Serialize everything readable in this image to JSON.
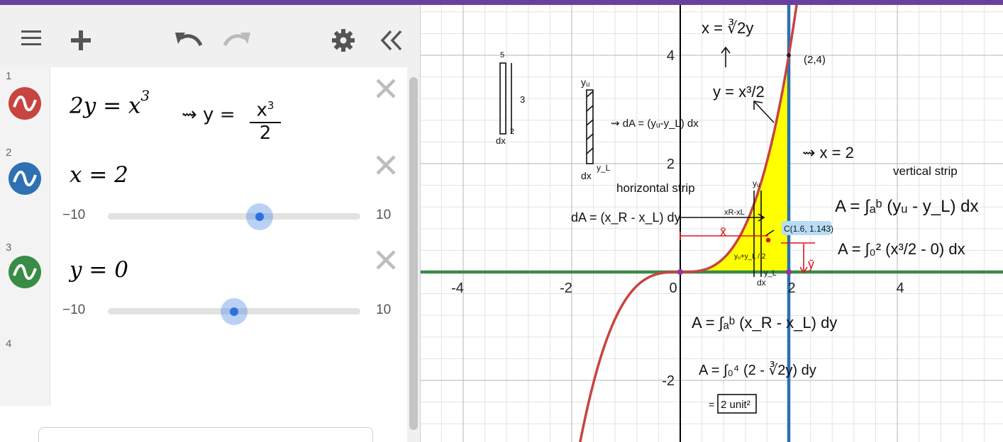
{
  "colors": {
    "top_bar": "#6b3fa0",
    "expr1": "#c74440",
    "expr2": "#2d70b3",
    "expr3": "#388c46",
    "fill": "#ffff00",
    "slider_dot": "#2d70e0"
  },
  "toolbar": {
    "menu_icon": "hamburger-icon",
    "add_icon": "plus-icon",
    "undo_icon": "undo-icon",
    "redo_icon": "redo-icon",
    "settings_icon": "gear-icon",
    "collapse_icon": "double-chevron-left-icon"
  },
  "expressions": [
    {
      "index": "1",
      "lhs": "2y = x",
      "exp": "3",
      "note_lhs": "⇝ y =",
      "note_num": "x",
      "note_num_exp": "3",
      "note_den": "2"
    },
    {
      "index": "2",
      "latex": "x = 2",
      "slider_min": "−10",
      "slider_max": "10",
      "value": 2
    },
    {
      "index": "3",
      "latex": "y = 0",
      "slider_min": "−10",
      "slider_max": "10",
      "value": 0
    },
    {
      "index": "4"
    }
  ],
  "graph": {
    "x_ticks": [
      "-4",
      "-2",
      "0",
      "2",
      "4"
    ],
    "y_ticks": [
      "4",
      "2",
      "-2"
    ],
    "x_range": [
      -4.8,
      5.9
    ],
    "y_range": [
      -3.0,
      5.0
    ],
    "point_label": "(2,4)",
    "annotations": {
      "top_eq": "x = ∛2y",
      "curve_eq": "y = x³/2",
      "line_label": "⇝ x = 2",
      "vertical_strip": "vertical strip",
      "area_vertical_general": "A = ∫ₐᵇ (yᵤ - y_L) dx",
      "area_vertical_specific": "A = ∫₀² (x³/2 - 0) dx",
      "horizontal_strip": "horizontal strip",
      "dA_horizontal": "dA = (x_R - x_L) dy",
      "dA_vertical": "⇝ dA = (yᵤ-y_L) dx",
      "strip_yu": "yᵤ",
      "strip_yl": "y_L",
      "strip_dx": "dx",
      "small_5": "5",
      "small_3": "3",
      "small_2": "2",
      "small_dx": "dx",
      "xr_xl": "xR-xL",
      "xbar": "x̄",
      "ybar": "ȳ",
      "centroid": "C(1.6, 1.143)",
      "yu_plus_yl": "yᵤ+y_L / 2",
      "yu_near": "yᵤ",
      "yl_near": "y_L",
      "dx_near": "dx",
      "area_horizontal_general": "A = ∫ₐᵇ (x_R - x_L) dy",
      "area_horizontal_specific": "A = ∫₀⁴ (2 - ∛2y) dy",
      "result": "2 unit²",
      "result_prefix": "="
    }
  }
}
